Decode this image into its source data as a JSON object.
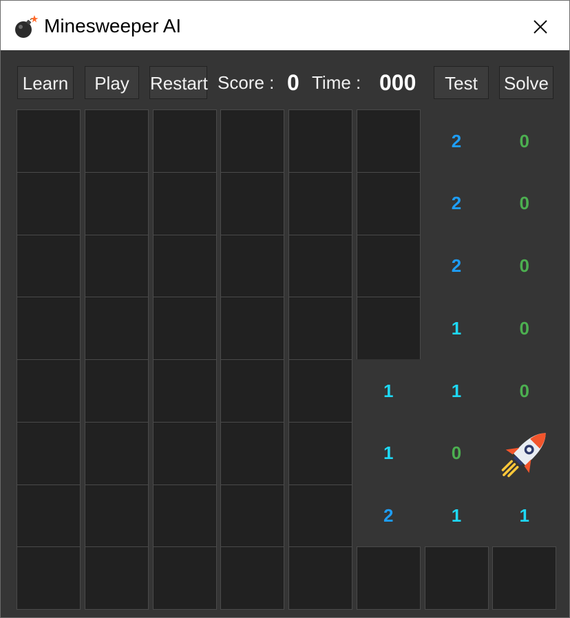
{
  "window": {
    "title": "Minesweeper AI",
    "app_icon": "bomb-icon",
    "close_icon": "close-icon"
  },
  "toolbar": {
    "learn_label": "Learn",
    "play_label": "Play",
    "restart_label": "Restart",
    "score_label": "Score :",
    "score_value": "0",
    "time_label": "Time :",
    "time_value": "000",
    "test_label": "Test",
    "solve_label": "Solve"
  },
  "colors": {
    "one": "#1ed8f5",
    "two": "#1e9df5",
    "zero": "#4caf50",
    "hidden_cell": "#212121",
    "background": "#353535"
  },
  "board": {
    "rows": 8,
    "cols": 8,
    "cells": [
      [
        "H",
        "H",
        "H",
        "H",
        "H",
        "H",
        "2",
        "0"
      ],
      [
        "H",
        "H",
        "H",
        "H",
        "H",
        "H",
        "2",
        "0"
      ],
      [
        "H",
        "H",
        "H",
        "H",
        "H",
        "H",
        "2",
        "0"
      ],
      [
        "H",
        "H",
        "H",
        "H",
        "H",
        "H",
        "1",
        "0"
      ],
      [
        "H",
        "H",
        "H",
        "H",
        "H",
        "1",
        "1",
        "0"
      ],
      [
        "H",
        "H",
        "H",
        "H",
        "H",
        "1",
        "0",
        "R"
      ],
      [
        "H",
        "H",
        "H",
        "H",
        "H",
        "2",
        "1",
        "1"
      ],
      [
        "H",
        "H",
        "H",
        "H",
        "H",
        "H",
        "H",
        "H"
      ]
    ],
    "agent_icon": "rocket-icon"
  }
}
